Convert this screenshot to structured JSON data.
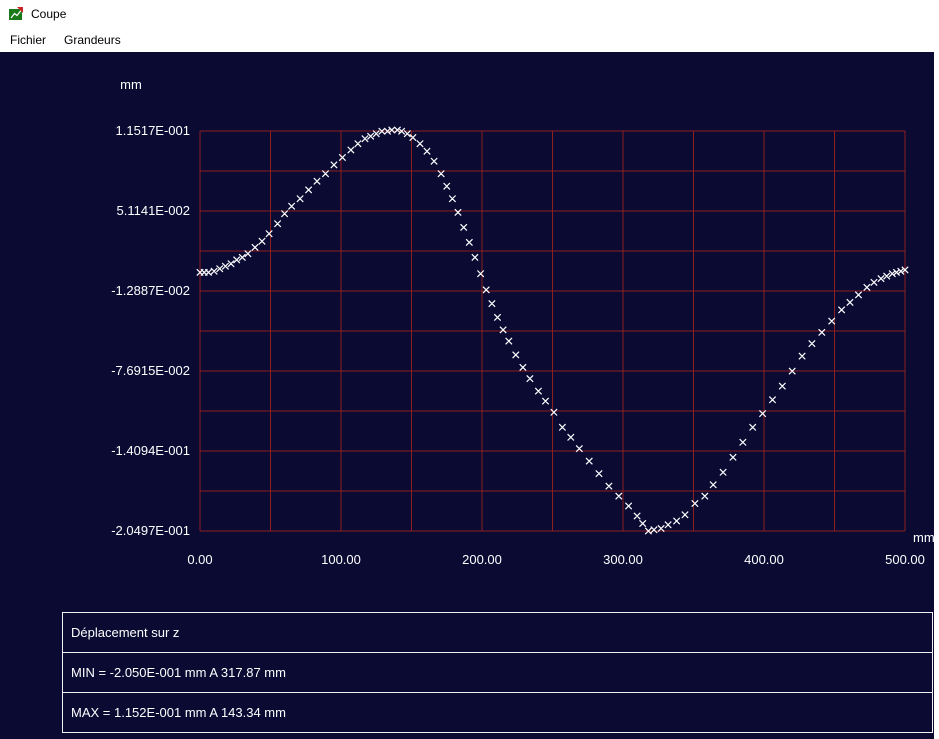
{
  "window": {
    "title": "Coupe",
    "menus": [
      "Fichier",
      "Grandeurs"
    ]
  },
  "colors": {
    "client_bg": "#0a0a33",
    "grid": "#8e1f1f",
    "marker": "#ffffff",
    "text": "#ffffff",
    "panel_border": "#f2f2f2",
    "header_bg": "#ffffff",
    "header_text": "#000000"
  },
  "info": {
    "rows": [
      "Déplacement sur z",
      "MIN = -2.050E-001 mm  A 317.87 mm",
      "MAX = 1.152E-001 mm  A 143.34 mm"
    ]
  },
  "chart_data": {
    "type": "scatter",
    "marker": "x",
    "title": "Déplacement sur z",
    "x_unit": "mm",
    "y_unit": "mm",
    "xlabel": "mm",
    "ylabel": "mm",
    "xlim": [
      0,
      500
    ],
    "ylim": [
      -0.20497,
      0.11517
    ],
    "grid_cols": 10,
    "grid_rows": 10,
    "grid_on": true,
    "x_ticks": [
      "0.00",
      "100.00",
      "200.00",
      "300.00",
      "400.00",
      "500.00"
    ],
    "y_ticks": [
      "1.1517E-001",
      "5.1141E-002",
      "-1.2887E-002",
      "-7.6915E-002",
      "-1.4094E-001",
      "-2.0497E-001"
    ],
    "min_annotation": {
      "value": "-2.050E-001 mm",
      "at": "317.87 mm"
    },
    "max_annotation": {
      "value": "1.152E-001 mm",
      "at": "143.34 mm"
    },
    "points": [
      [
        0,
        0.002
      ],
      [
        3,
        0.002
      ],
      [
        6,
        0.002
      ],
      [
        10,
        0.003
      ],
      [
        14,
        0.005
      ],
      [
        18,
        0.007
      ],
      [
        22,
        0.009
      ],
      [
        26,
        0.012
      ],
      [
        30,
        0.014
      ],
      [
        34,
        0.017
      ],
      [
        39,
        0.022
      ],
      [
        44,
        0.027
      ],
      [
        49,
        0.033
      ],
      [
        55,
        0.041
      ],
      [
        60,
        0.049
      ],
      [
        65,
        0.055
      ],
      [
        71,
        0.061
      ],
      [
        77,
        0.068
      ],
      [
        83,
        0.075
      ],
      [
        89,
        0.081
      ],
      [
        95,
        0.088
      ],
      [
        101,
        0.094
      ],
      [
        107,
        0.1
      ],
      [
        112,
        0.105
      ],
      [
        117,
        0.109
      ],
      [
        121,
        0.111
      ],
      [
        125,
        0.113
      ],
      [
        129,
        0.115
      ],
      [
        133,
        0.115
      ],
      [
        136,
        0.116
      ],
      [
        140,
        0.116
      ],
      [
        143,
        0.115
      ],
      [
        147,
        0.113
      ],
      [
        151,
        0.11
      ],
      [
        156,
        0.105
      ],
      [
        161,
        0.099
      ],
      [
        166,
        0.091
      ],
      [
        171,
        0.081
      ],
      [
        175,
        0.071
      ],
      [
        179,
        0.061
      ],
      [
        183,
        0.05
      ],
      [
        187,
        0.038
      ],
      [
        191,
        0.026
      ],
      [
        195,
        0.014
      ],
      [
        199,
        0.001
      ],
      [
        203,
        -0.012
      ],
      [
        207,
        -0.023
      ],
      [
        211,
        -0.034
      ],
      [
        215,
        -0.044
      ],
      [
        219,
        -0.053
      ],
      [
        224,
        -0.064
      ],
      [
        229,
        -0.074
      ],
      [
        234,
        -0.083
      ],
      [
        240,
        -0.093
      ],
      [
        245,
        -0.101
      ],
      [
        251,
        -0.11
      ],
      [
        257,
        -0.122
      ],
      [
        263,
        -0.13
      ],
      [
        269,
        -0.139
      ],
      [
        276,
        -0.149
      ],
      [
        283,
        -0.159
      ],
      [
        290,
        -0.169
      ],
      [
        297,
        -0.177
      ],
      [
        304,
        -0.185
      ],
      [
        310,
        -0.193
      ],
      [
        314,
        -0.199
      ],
      [
        318,
        -0.205
      ],
      [
        322,
        -0.204
      ],
      [
        327,
        -0.203
      ],
      [
        332,
        -0.2
      ],
      [
        338,
        -0.197
      ],
      [
        344,
        -0.192
      ],
      [
        351,
        -0.183
      ],
      [
        358,
        -0.177
      ],
      [
        364,
        -0.168
      ],
      [
        371,
        -0.158
      ],
      [
        378,
        -0.146
      ],
      [
        385,
        -0.134
      ],
      [
        392,
        -0.122
      ],
      [
        399,
        -0.111
      ],
      [
        406,
        -0.1
      ],
      [
        413,
        -0.089
      ],
      [
        420,
        -0.077
      ],
      [
        427,
        -0.065
      ],
      [
        434,
        -0.055
      ],
      [
        441,
        -0.046
      ],
      [
        448,
        -0.037
      ],
      [
        455,
        -0.028
      ],
      [
        461,
        -0.022
      ],
      [
        467,
        -0.016
      ],
      [
        473,
        -0.01
      ],
      [
        478,
        -0.006
      ],
      [
        483,
        -0.003
      ],
      [
        487,
        -0.001
      ],
      [
        491,
        0.001
      ],
      [
        494,
        0.002
      ],
      [
        497,
        0.003
      ],
      [
        500,
        0.004
      ]
    ]
  }
}
